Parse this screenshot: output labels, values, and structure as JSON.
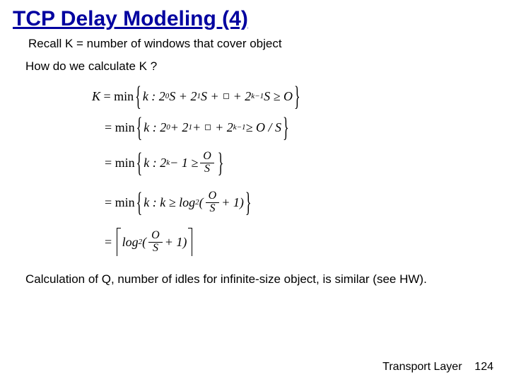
{
  "title": "TCP Delay Modeling (4)",
  "line1": "Recall K = number of windows that cover object",
  "line2": "How do we calculate K ?",
  "formula": {
    "r1a": "K",
    "r1b": "= min",
    "r1c": "k : 2",
    "r1s0": "0",
    "r1d": "S + 2",
    "r1s1": "1",
    "r1e": "S +",
    "r1f": "+ 2",
    "r1sk": "k−1",
    "r1g": "S ≥ O",
    "r2a": "= min",
    "r2b": "k : 2",
    "r2s0": "0",
    "r2c": " + 2",
    "r2s1": "1",
    "r2d": " +",
    "r2e": "+ 2",
    "r2sk": "k−1",
    "r2f": " ≥ O / S",
    "r3a": "= min",
    "r3b": "k : 2",
    "r3sk": "k",
    "r3c": " − 1 ≥ ",
    "fracO": "O",
    "fracS": "S",
    "r4a": "= min",
    "r4b": "k : k ≥ log",
    "r4s2": "2",
    "r4c": "(",
    "r4d": " + 1)",
    "r5a": "=",
    "r5b": "log",
    "r5s2": "2",
    "r5c": "(",
    "r5d": " + 1)"
  },
  "bottom": "Calculation of Q, number  of idles for infinite-size object, is similar (see HW).",
  "footer_label": "Transport Layer",
  "footer_num": "124"
}
